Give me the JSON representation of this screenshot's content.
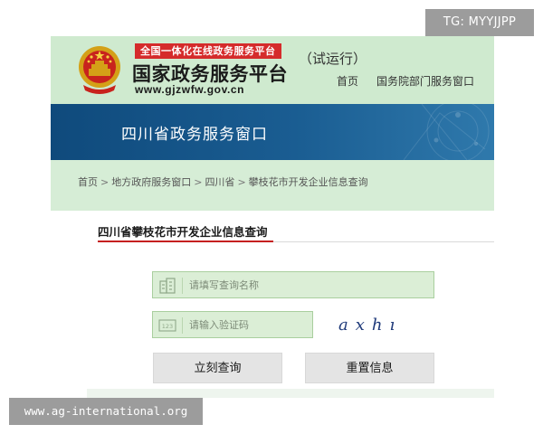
{
  "watermarks": {
    "top_right": "TG: MYYJJPP",
    "bottom_left": "www.ag-international.org"
  },
  "header": {
    "slogan": "全国一体化在线政务服务平台",
    "site_name": "国家政务服务平台",
    "site_url": "www.gjzwfw.gov.cn",
    "trial_label": "（试运行）",
    "nav": {
      "home": "首页",
      "departments": "国务院部门服务窗口"
    }
  },
  "banner": {
    "title": "四川省政务服务窗口"
  },
  "breadcrumb": {
    "items": [
      "首页",
      "地方政府服务窗口",
      "四川省",
      "攀枝花市开发企业信息查询"
    ],
    "separator": ">"
  },
  "panel": {
    "title": "四川省攀枝花市开发企业信息查询",
    "name_input": {
      "placeholder": "请填写查询名称",
      "value": ""
    },
    "code_input": {
      "placeholder": "请输入验证码",
      "value": "",
      "icon_label": "123"
    },
    "captcha_text": "axhı",
    "buttons": {
      "query": "立刻查询",
      "reset": "重置信息"
    }
  },
  "colors": {
    "header_bg": "#cfeacf",
    "banner_bg": "#1a5d92",
    "accent_red": "#c51f1f",
    "field_bg": "#dbeed6",
    "button_bg": "#e4e4e4"
  },
  "icons": {
    "emblem": "national-emblem-icon",
    "name_field": "building-icon",
    "code_field": "keypad-icon"
  }
}
